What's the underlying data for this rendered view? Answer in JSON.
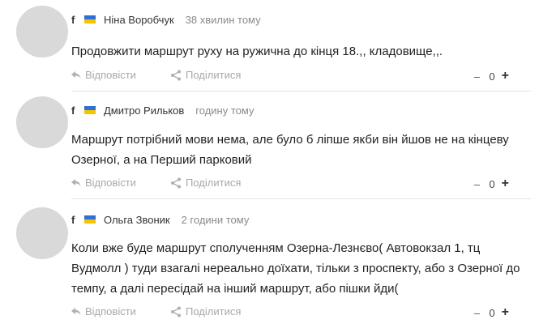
{
  "comments": [
    {
      "social": "f",
      "author": "Ніна Воробчук",
      "time": "38 хвилин тому",
      "text": "Продовжити маршрут руху на ружична до кінця 18.,, кладовище,,.",
      "reply_label": "Відповісти",
      "share_label": "Поділитися",
      "minus": "–",
      "count": "0",
      "plus": "+"
    },
    {
      "social": "f",
      "author": "Дмитро Рильков",
      "time": "годину тому",
      "text": "Маршрут потрібний мови нема, але було б ліпше якби він йшов не на кінцеву Озерної, а на Перший парковий",
      "reply_label": "Відповісти",
      "share_label": "Поділитися",
      "minus": "–",
      "count": "0",
      "plus": "+"
    },
    {
      "social": "f",
      "author": "Ольга Звоник",
      "time": "2 години тому",
      "text": "Коли вже буде маршрут сполученням Озерна-Лезнєво( Автовокзал 1, тц Вудмолл ) туди взагалі нереально доїхати, тільки з проспекту, або з Озерної до темпу, а далі пересідай на інший маршрут, або пішки йди(",
      "reply_label": "Відповісти",
      "share_label": "Поділитися",
      "minus": "–",
      "count": "0",
      "plus": "+"
    }
  ],
  "colors": {
    "flag_blue": "#2f6fd6",
    "flag_yellow": "#f5c400",
    "avatar": "#d9d9d9"
  }
}
